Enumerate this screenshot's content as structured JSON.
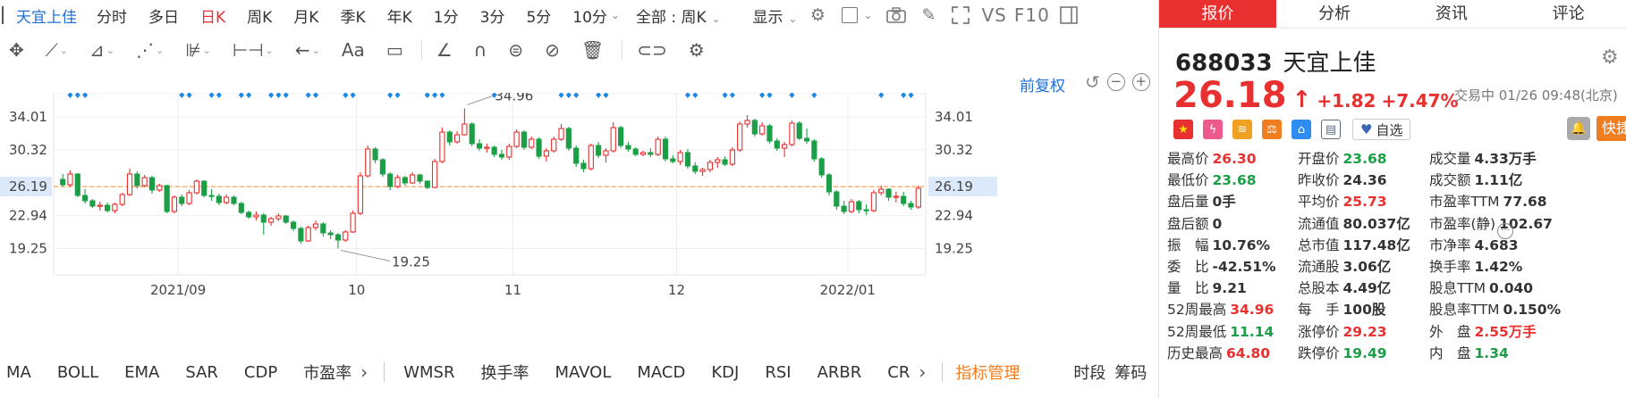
{
  "toolbar": {
    "stock_name": "天宜上佳",
    "periods": [
      "分时",
      "多日",
      "日K",
      "周K",
      "月K",
      "季K",
      "年K",
      "1分",
      "3分",
      "5分",
      "10分"
    ],
    "active_period": "日K",
    "adjust_select": "全部 : 周K",
    "display_label": "显示",
    "vs_label": "VS",
    "f10_label": "F10"
  },
  "tools": {
    "text_tool": "Aa"
  },
  "chart_header": {
    "restore_label": "前复权"
  },
  "chart_data": {
    "type": "candlestick",
    "y_ticks": [
      34.01,
      30.32,
      26.19,
      22.94,
      19.25
    ],
    "current_price_line": 26.19,
    "x_labels": [
      "2021/09",
      "10",
      "11",
      "12",
      "2022/01"
    ],
    "annotations": [
      {
        "label": "34.96",
        "value": 34.96
      },
      {
        "label": "19.25",
        "value": 19.25
      }
    ],
    "up_color": "#e93030",
    "down_color": "#1b9e46",
    "marker_color": "#1e88e5",
    "candles": [
      [
        27.0,
        27.6,
        26.2,
        26.4
      ],
      [
        26.4,
        28.0,
        26.2,
        27.6
      ],
      [
        27.6,
        27.7,
        25.0,
        25.2
      ],
      [
        25.2,
        25.9,
        24.3,
        24.6
      ],
      [
        24.6,
        24.8,
        23.8,
        24.0
      ],
      [
        24.0,
        24.5,
        23.5,
        24.1
      ],
      [
        24.1,
        24.4,
        23.3,
        23.5
      ],
      [
        23.5,
        24.4,
        23.2,
        24.2
      ],
      [
        24.2,
        25.5,
        24.0,
        25.3
      ],
      [
        25.3,
        28.2,
        25.1,
        27.6
      ],
      [
        27.6,
        27.9,
        26.0,
        26.3
      ],
      [
        26.3,
        27.5,
        26.1,
        27.2
      ],
      [
        27.2,
        27.4,
        25.4,
        25.8
      ],
      [
        25.8,
        26.5,
        25.6,
        26.3
      ],
      [
        26.3,
        26.4,
        23.2,
        23.4
      ],
      [
        23.4,
        25.2,
        23.2,
        25.0
      ],
      [
        25.0,
        25.3,
        24.0,
        24.3
      ],
      [
        24.3,
        25.8,
        24.1,
        25.5
      ],
      [
        25.5,
        27.0,
        25.3,
        26.8
      ],
      [
        26.8,
        26.9,
        25.0,
        25.2
      ],
      [
        25.2,
        25.9,
        24.6,
        25.1
      ],
      [
        25.1,
        25.4,
        24.1,
        24.4
      ],
      [
        24.4,
        25.3,
        24.2,
        25.0
      ],
      [
        25.0,
        25.2,
        24.1,
        24.3
      ],
      [
        24.3,
        24.5,
        23.1,
        23.3
      ],
      [
        23.3,
        23.5,
        22.6,
        22.8
      ],
      [
        22.8,
        23.4,
        22.4,
        23.0
      ],
      [
        23.0,
        23.2,
        20.8,
        22.2
      ],
      [
        22.2,
        22.8,
        21.8,
        22.6
      ],
      [
        22.6,
        23.2,
        22.3,
        22.9
      ],
      [
        22.9,
        23.0,
        22.0,
        22.2
      ],
      [
        22.2,
        22.4,
        21.2,
        21.5
      ],
      [
        21.5,
        21.7,
        19.8,
        20.1
      ],
      [
        20.1,
        21.8,
        20.0,
        21.6
      ],
      [
        21.6,
        22.4,
        21.3,
        22.0
      ],
      [
        22.0,
        22.2,
        20.6,
        21.0
      ],
      [
        21.0,
        21.3,
        20.3,
        20.8
      ],
      [
        20.8,
        21.0,
        19.25,
        20.2
      ],
      [
        20.2,
        21.3,
        20.0,
        21.1
      ],
      [
        21.1,
        23.5,
        21.0,
        23.2
      ],
      [
        23.2,
        27.8,
        23.0,
        27.4
      ],
      [
        27.4,
        30.8,
        27.2,
        30.4
      ],
      [
        30.4,
        30.6,
        28.8,
        29.2
      ],
      [
        29.2,
        29.4,
        27.3,
        27.6
      ],
      [
        27.6,
        27.8,
        25.8,
        26.2
      ],
      [
        26.2,
        27.5,
        26.0,
        27.2
      ],
      [
        27.2,
        27.4,
        26.3,
        26.6
      ],
      [
        26.6,
        27.8,
        26.5,
        27.5
      ],
      [
        27.5,
        27.6,
        26.5,
        26.8
      ],
      [
        26.8,
        26.9,
        25.9,
        26.1
      ],
      [
        26.1,
        29.3,
        26.0,
        29.0
      ],
      [
        29.0,
        32.8,
        28.8,
        32.3
      ],
      [
        32.3,
        32.5,
        30.8,
        31.2
      ],
      [
        31.2,
        32.4,
        31.0,
        32.0
      ],
      [
        32.0,
        34.96,
        31.9,
        33.2
      ],
      [
        33.2,
        33.4,
        30.7,
        31.0
      ],
      [
        31.0,
        31.5,
        30.2,
        30.5
      ],
      [
        30.5,
        31.0,
        30.0,
        30.6
      ],
      [
        30.6,
        30.8,
        29.5,
        29.8
      ],
      [
        29.8,
        30.3,
        29.2,
        29.5
      ],
      [
        29.5,
        31.0,
        29.2,
        30.7
      ],
      [
        30.7,
        32.6,
        30.5,
        32.3
      ],
      [
        32.3,
        32.5,
        30.3,
        30.6
      ],
      [
        30.6,
        31.8,
        30.4,
        31.5
      ],
      [
        31.5,
        31.7,
        29.3,
        29.6
      ],
      [
        29.6,
        30.5,
        29.0,
        30.2
      ],
      [
        30.2,
        31.8,
        30.0,
        31.5
      ],
      [
        31.5,
        33.2,
        31.3,
        32.7
      ],
      [
        32.7,
        32.9,
        30.2,
        30.5
      ],
      [
        30.5,
        30.8,
        28.4,
        28.8
      ],
      [
        28.8,
        29.2,
        27.8,
        28.2
      ],
      [
        28.2,
        31.0,
        28.0,
        30.8
      ],
      [
        30.8,
        31.2,
        29.4,
        29.7
      ],
      [
        29.7,
        30.5,
        28.9,
        30.2
      ],
      [
        30.2,
        33.4,
        30.0,
        32.8
      ],
      [
        32.8,
        33.0,
        30.5,
        30.8
      ],
      [
        30.8,
        31.2,
        30.1,
        30.4
      ],
      [
        30.4,
        30.6,
        29.6,
        29.8
      ],
      [
        29.8,
        30.2,
        29.6,
        30.0
      ],
      [
        30.0,
        30.5,
        29.5,
        29.8
      ],
      [
        29.8,
        31.8,
        29.6,
        31.5
      ],
      [
        31.5,
        31.8,
        29.0,
        29.3
      ],
      [
        29.3,
        29.7,
        28.8,
        29.0
      ],
      [
        29.0,
        30.3,
        28.6,
        30.0
      ],
      [
        30.0,
        30.4,
        28.2,
        28.5
      ],
      [
        28.5,
        28.9,
        27.6,
        27.9
      ],
      [
        27.9,
        28.3,
        27.4,
        28.1
      ],
      [
        28.1,
        29.2,
        27.8,
        28.9
      ],
      [
        28.9,
        29.5,
        28.3,
        29.2
      ],
      [
        29.2,
        29.6,
        28.5,
        28.7
      ],
      [
        28.7,
        30.6,
        28.5,
        30.3
      ],
      [
        30.3,
        33.5,
        30.1,
        33.2
      ],
      [
        33.2,
        34.2,
        32.8,
        33.6
      ],
      [
        33.6,
        33.8,
        31.8,
        32.1
      ],
      [
        32.1,
        33.4,
        31.9,
        33.0
      ],
      [
        33.0,
        33.2,
        31.0,
        31.3
      ],
      [
        31.3,
        31.6,
        30.2,
        30.5
      ],
      [
        30.5,
        31.2,
        29.5,
        30.9
      ],
      [
        30.9,
        33.6,
        30.7,
        33.3
      ],
      [
        33.3,
        33.5,
        31.4,
        31.6
      ],
      [
        31.6,
        32.7,
        31.0,
        31.3
      ],
      [
        31.3,
        31.5,
        29.0,
        29.3
      ],
      [
        29.3,
        29.5,
        27.2,
        27.5
      ],
      [
        27.5,
        27.7,
        25.2,
        25.6
      ],
      [
        25.6,
        25.8,
        23.6,
        24.0
      ],
      [
        24.0,
        24.6,
        23.1,
        23.4
      ],
      [
        23.4,
        24.8,
        23.2,
        24.5
      ],
      [
        24.5,
        24.7,
        23.2,
        23.6
      ],
      [
        23.6,
        24.2,
        23.0,
        23.5
      ],
      [
        23.5,
        25.8,
        23.3,
        25.5
      ],
      [
        25.5,
        26.3,
        25.2,
        25.9
      ],
      [
        25.9,
        26.0,
        24.6,
        25.0
      ],
      [
        25.0,
        25.6,
        24.4,
        25.1
      ],
      [
        25.1,
        25.6,
        24.0,
        24.3
      ],
      [
        24.3,
        24.6,
        23.6,
        23.9
      ],
      [
        23.9,
        26.3,
        23.7,
        26.0
      ]
    ],
    "markers": [
      1,
      2,
      3,
      16,
      17,
      20,
      21,
      24,
      25,
      28,
      29,
      30,
      33,
      34,
      38,
      39,
      44,
      45,
      49,
      50,
      51,
      58,
      67,
      68,
      69,
      72,
      73,
      84,
      85,
      89,
      90,
      94,
      95,
      98,
      101,
      110,
      113,
      114
    ]
  },
  "indicators": {
    "left": [
      "MA",
      "BOLL",
      "EMA",
      "SAR",
      "CDP",
      "市盈率"
    ],
    "right": [
      "WMSR",
      "换手率",
      "MAVOL",
      "MACD",
      "KDJ",
      "RSI",
      "ARBR",
      "CR"
    ],
    "arrow": "›",
    "manage": "指标管理",
    "tail": [
      "时段",
      "筹码"
    ]
  },
  "panel": {
    "tabs": [
      "报价",
      "分析",
      "资讯",
      "评论"
    ],
    "active_tab": "报价",
    "code": "688033",
    "name": "天宜上佳",
    "price": "26.18",
    "up_arrow": "↑",
    "change": "+1.82",
    "change_pct": "+7.47%",
    "trade_status": "交易中 01/26 09:48(北京)",
    "fav_label": "自选",
    "quick_trade": "快捷交易"
  },
  "stats": [
    {
      "label": "最高价",
      "value": "26.30",
      "tone": "red"
    },
    {
      "label": "开盘价",
      "value": "23.68",
      "tone": "green"
    },
    {
      "label": "成交量",
      "value": "4.33万手",
      "tone": "black"
    },
    {
      "label": "最低价",
      "value": "23.68",
      "tone": "green"
    },
    {
      "label": "昨收价",
      "value": "24.36",
      "tone": "black"
    },
    {
      "label": "成交额",
      "value": "1.11亿",
      "tone": "black"
    },
    {
      "label": "盘后量",
      "value": "0手",
      "tone": "black"
    },
    {
      "label": "平均价",
      "value": "25.73",
      "tone": "red"
    },
    {
      "label": "市盈率TTM",
      "value": "77.68",
      "tone": "black"
    },
    {
      "label": "盘后额",
      "value": "0",
      "tone": "black"
    },
    {
      "label": "流通值",
      "value": "80.037亿",
      "tone": "black"
    },
    {
      "label": "市盈率(静)",
      "value": "102.67",
      "tone": "black"
    },
    {
      "label": "振　幅",
      "value": "10.76%",
      "tone": "black"
    },
    {
      "label": "总市值",
      "value": "117.48亿",
      "tone": "black"
    },
    {
      "label": "市净率",
      "value": "4.683",
      "tone": "black"
    },
    {
      "label": "委　比",
      "value": "-42.51%",
      "tone": "black"
    },
    {
      "label": "流通股",
      "value": "3.06亿",
      "tone": "black"
    },
    {
      "label": "换手率",
      "value": "1.42%",
      "tone": "black"
    },
    {
      "label": "量　比",
      "value": "9.21",
      "tone": "black"
    },
    {
      "label": "总股本",
      "value": "4.49亿",
      "tone": "black"
    },
    {
      "label": "股息TTM",
      "value": "0.040",
      "tone": "black"
    },
    {
      "label": "52周最高",
      "value": "34.96",
      "tone": "red"
    },
    {
      "label": "每　手",
      "value": "100股",
      "tone": "black"
    },
    {
      "label": "股息率TTM",
      "value": "0.150%",
      "tone": "black"
    },
    {
      "label": "52周最低",
      "value": "11.14",
      "tone": "green"
    },
    {
      "label": "涨停价",
      "value": "29.23",
      "tone": "red"
    },
    {
      "label": "外　盘",
      "value": "2.55万手",
      "tone": "red"
    },
    {
      "label": "历史最高",
      "value": "64.80",
      "tone": "red"
    },
    {
      "label": "跌停价",
      "value": "19.49",
      "tone": "green"
    },
    {
      "label": "内　盘",
      "value": "1.34",
      "tone": "green"
    }
  ]
}
